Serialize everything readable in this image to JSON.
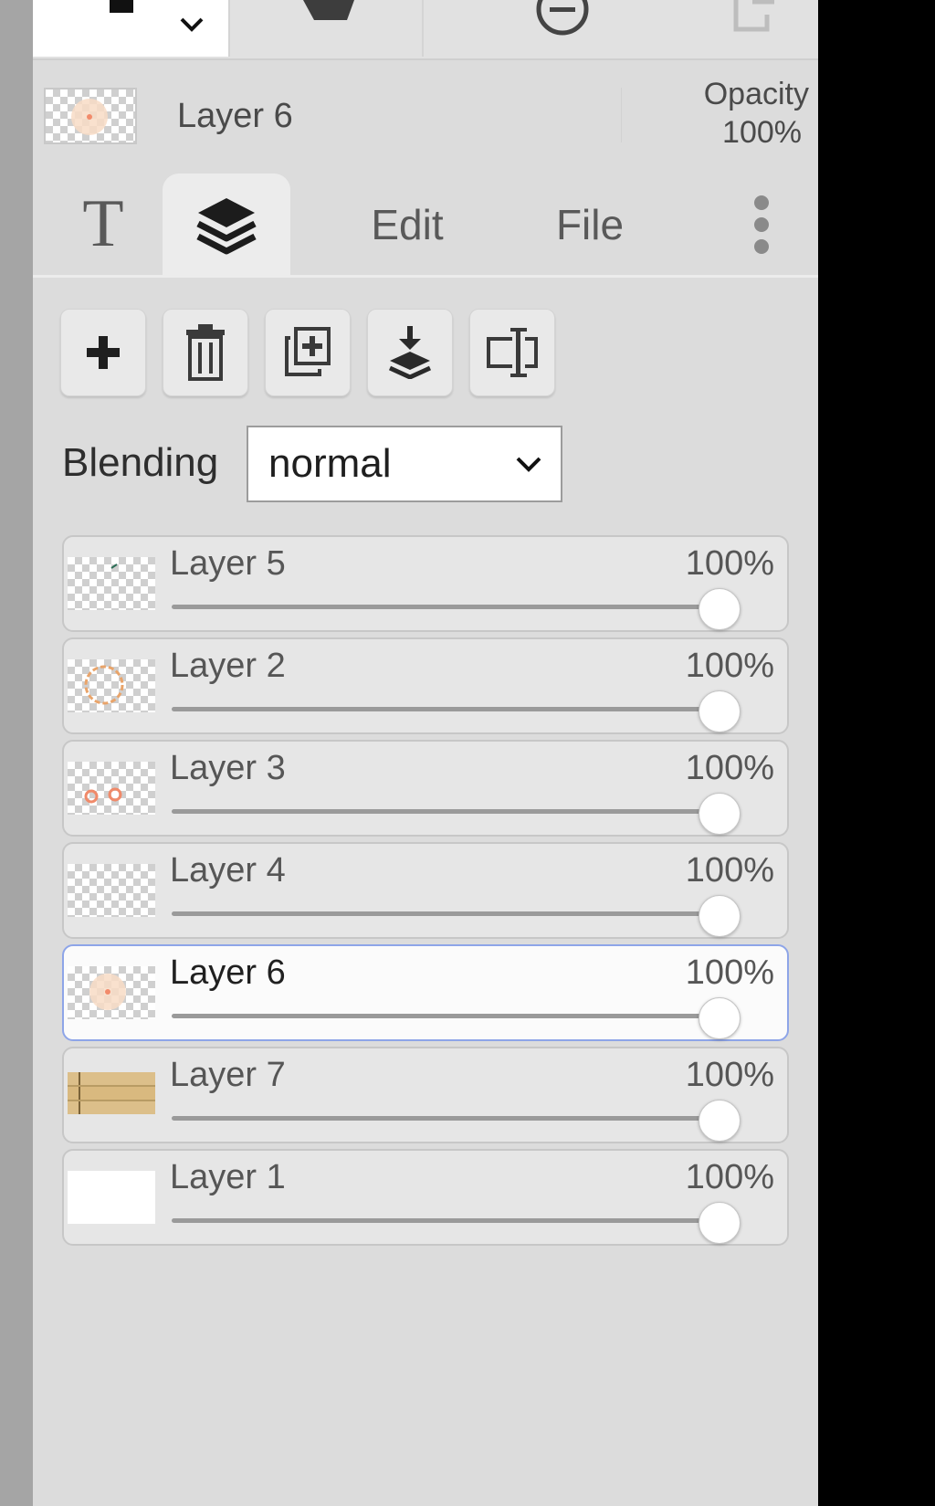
{
  "top_toolbar": {
    "active_tool": "brush",
    "tools": [
      "brush-icon",
      "hand-icon",
      "zoom-out-icon",
      "export-icon"
    ]
  },
  "current_layer": {
    "name": "Layer 6",
    "opacity_label": "Opacity",
    "opacity_value": "100%"
  },
  "tabs": [
    {
      "label": "T",
      "icon": "text-icon"
    },
    {
      "label": "",
      "icon": "layers-icon",
      "active": true
    },
    {
      "label": "Edit"
    },
    {
      "label": "File"
    },
    {
      "label": "",
      "icon": "more-vertical-icon"
    }
  ],
  "actions": [
    {
      "name": "add-layer-button",
      "icon": "plus-icon"
    },
    {
      "name": "delete-layer-button",
      "icon": "trash-icon"
    },
    {
      "name": "duplicate-layer-button",
      "icon": "duplicate-icon"
    },
    {
      "name": "merge-down-button",
      "icon": "merge-down-icon"
    },
    {
      "name": "rename-layer-button",
      "icon": "rename-icon"
    }
  ],
  "blending": {
    "label": "Blending",
    "selected": "normal"
  },
  "layers": [
    {
      "name": "Layer 5",
      "opacity": "100%",
      "opacity_fraction": 1.0,
      "selected": false,
      "thumb": "transparent-sketch"
    },
    {
      "name": "Layer 2",
      "opacity": "100%",
      "opacity_fraction": 1.0,
      "selected": false,
      "thumb": "orange-circle"
    },
    {
      "name": "Layer 3",
      "opacity": "100%",
      "opacity_fraction": 1.0,
      "selected": false,
      "thumb": "red-marks"
    },
    {
      "name": "Layer 4",
      "opacity": "100%",
      "opacity_fraction": 1.0,
      "selected": false,
      "thumb": "transparent"
    },
    {
      "name": "Layer 6",
      "opacity": "100%",
      "opacity_fraction": 1.0,
      "selected": true,
      "thumb": "peach-circle"
    },
    {
      "name": "Layer 7",
      "opacity": "100%",
      "opacity_fraction": 1.0,
      "selected": false,
      "thumb": "wood-planks"
    },
    {
      "name": "Layer 1",
      "opacity": "100%",
      "opacity_fraction": 1.0,
      "selected": false,
      "thumb": "white-fill"
    }
  ],
  "colors": {
    "panel_bg": "#dcdcdc",
    "selected_border": "#8ea5e8",
    "row_bg": "#e6e6e6",
    "selected_row_bg": "#fbfbfb"
  }
}
